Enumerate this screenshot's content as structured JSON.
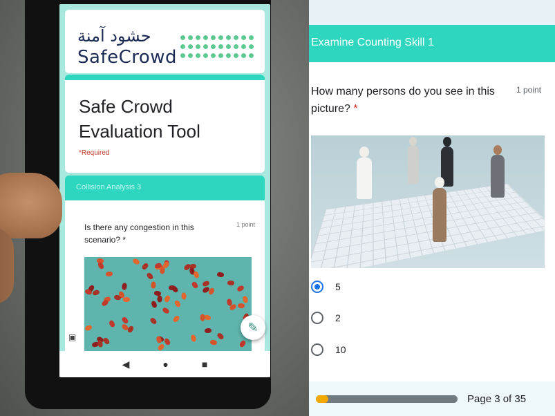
{
  "phone": {
    "logo_arabic": "حشود آمنة",
    "logo_english": "SafeCrowd",
    "form_title": "Safe Crowd Evaluation Tool",
    "required_note": "*Required",
    "section_title": "Collision Analysis 3",
    "question": "Is there any congestion in this scenario? *",
    "points": "1 point",
    "nav": {
      "back": "◀",
      "home": "●",
      "recent": "■"
    },
    "fab_icon": "pencil-icon",
    "feedback_icon": "feedback-icon"
  },
  "form": {
    "section_title": "Examine Counting Skill 1",
    "question": "How many persons do you see in this picture?",
    "required_mark": "*",
    "points": "1 point",
    "options": [
      {
        "label": "5",
        "selected": true
      },
      {
        "label": "2",
        "selected": false
      },
      {
        "label": "10",
        "selected": false
      }
    ],
    "progress": {
      "current": 3,
      "total": 35,
      "label": "Page 3 of 35"
    }
  },
  "colors": {
    "accent": "#2fd6bf",
    "radio_selected": "#1a73e8",
    "progress_fill": "#f5a800"
  }
}
